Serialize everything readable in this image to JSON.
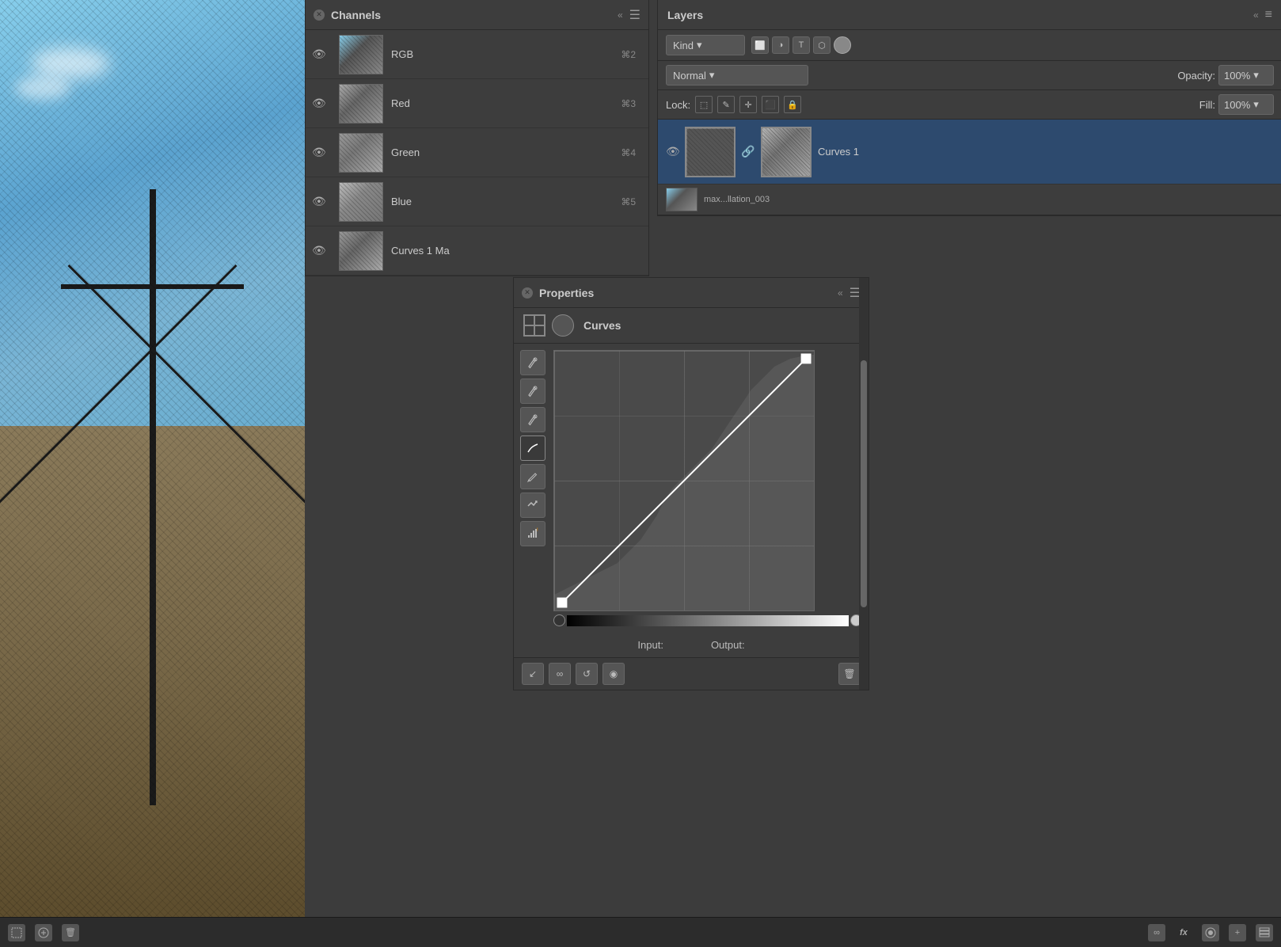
{
  "canvas": {
    "background": "photo of crosses/windmill structure"
  },
  "channels_panel": {
    "title": "Channels",
    "items": [
      {
        "name": "RGB",
        "shortcut": "⌘2",
        "visible": true,
        "type": "rgb"
      },
      {
        "name": "Red",
        "shortcut": "⌘3",
        "visible": true,
        "type": "red"
      },
      {
        "name": "Green",
        "shortcut": "⌘4",
        "visible": true,
        "type": "green"
      },
      {
        "name": "Blue",
        "shortcut": "⌘5",
        "visible": true,
        "type": "blue"
      },
      {
        "name": "Curves 1 Ma",
        "shortcut": "",
        "visible": true,
        "type": "curves"
      }
    ],
    "collapse": "«"
  },
  "layers_panel": {
    "title": "Layers",
    "collapse": "«",
    "kind_label": "Kind",
    "filter_icons": [
      "pixel",
      "adjustment",
      "type",
      "shape",
      "smart"
    ],
    "blend_mode": "Normal",
    "opacity_label": "Opacity:",
    "opacity_value": "100%",
    "fill_label": "Fill:",
    "fill_value": "100%",
    "lock_label": "Lock:",
    "lock_icons": [
      "transparent",
      "pixel",
      "position",
      "artboard",
      "all"
    ],
    "items": [
      {
        "name": "Curves 1",
        "type": "adjustment",
        "visible": true,
        "has_mask": true,
        "linked": true
      }
    ],
    "layer_strip_name": "max...llation_003",
    "menu_icon": "≡"
  },
  "properties_panel": {
    "title": "Properties",
    "collapse": "«",
    "curves_label": "Curves",
    "tools": [
      {
        "name": "eyedropper-white",
        "symbol": "✛",
        "tooltip": "Set white point"
      },
      {
        "name": "eyedropper-gray",
        "symbol": "✛",
        "tooltip": "Set gray point"
      },
      {
        "name": "eyedropper-black",
        "symbol": "✛",
        "tooltip": "Set black point"
      },
      {
        "name": "curve-smooth",
        "symbol": "∿",
        "tooltip": "Smooth curve"
      },
      {
        "name": "pencil",
        "symbol": "✏",
        "tooltip": "Draw curve"
      },
      {
        "name": "auto",
        "symbol": "⟵",
        "tooltip": "Auto"
      },
      {
        "name": "histogram-warning",
        "symbol": "⚠",
        "tooltip": "Histogram"
      }
    ],
    "input_label": "Input:",
    "output_label": "Output:",
    "bottom_tools": [
      {
        "name": "clip-to-layer",
        "symbol": "↙"
      },
      {
        "name": "link-layer",
        "symbol": "∞"
      },
      {
        "name": "reset",
        "symbol": "↺"
      },
      {
        "name": "visibility",
        "symbol": "◉"
      },
      {
        "name": "delete",
        "symbol": "🗑"
      }
    ]
  },
  "taskbar": {
    "icons": [
      "dotted-rect",
      "plus-circle",
      "trash",
      "link",
      "fx",
      "circle",
      "plus",
      "layers"
    ]
  }
}
